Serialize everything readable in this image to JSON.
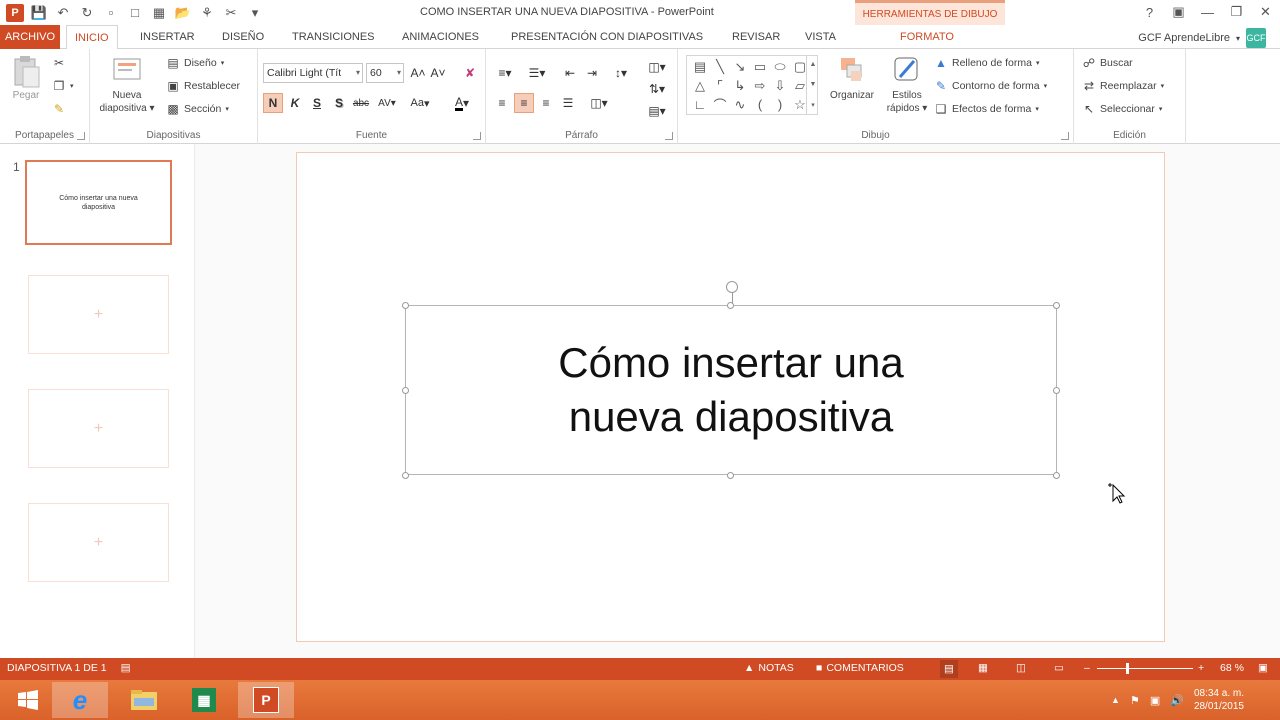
{
  "window": {
    "title": "COMO INSERTAR UNA NUEVA DIAPOSITIVA - PowerPoint",
    "context_header": "HERRAMIENTAS DE DIBUJO",
    "app_logo": "P"
  },
  "tabs": [
    {
      "label": "ARCHIVO"
    },
    {
      "label": "INICIO"
    },
    {
      "label": "INSERTAR"
    },
    {
      "label": "DISEÑO"
    },
    {
      "label": "TRANSICIONES"
    },
    {
      "label": "ANIMACIONES"
    },
    {
      "label": "PRESENTACIÓN CON DIAPOSITIVAS"
    },
    {
      "label": "REVISAR"
    },
    {
      "label": "VISTA"
    },
    {
      "label": "FORMATO"
    }
  ],
  "account": {
    "name": "GCF AprendeLibre",
    "avatar": "GCF"
  },
  "ribbon": {
    "clipboard": {
      "label": "Portapapeles",
      "paste": "Pegar"
    },
    "slides": {
      "label": "Diapositivas",
      "new_slide_line1": "Nueva",
      "new_slide_line2": "diapositiva",
      "layout": "Diseño",
      "reset": "Restablecer",
      "section": "Sección"
    },
    "font": {
      "label": "Fuente",
      "font_name": "Calibri Light (Tít",
      "font_size": "60",
      "bold": "N",
      "italic": "K",
      "underline": "S",
      "shadow": "S",
      "strike": "abc",
      "spacing": "AV",
      "case": "Aa"
    },
    "paragraph": {
      "label": "Párrafo"
    },
    "drawing": {
      "label": "Dibujo",
      "arrange": "Organizar",
      "quick_styles_line1": "Estilos",
      "quick_styles_line2": "rápidos",
      "fill": "Relleno de forma",
      "outline": "Contorno de forma",
      "effects": "Efectos de forma"
    },
    "editing": {
      "label": "Edición",
      "find": "Buscar",
      "replace": "Reemplazar",
      "select": "Seleccionar"
    }
  },
  "thumbnails": {
    "number": "1",
    "slide1_text": "Cómo insertar una nueva diapositiva"
  },
  "slide": {
    "title_line1": "Cómo insertar una",
    "title_line2": "nueva diapositiva"
  },
  "status": {
    "slide_count": "DIAPOSITIVA 1 DE 1",
    "notes": "NOTAS",
    "comments": "COMENTARIOS",
    "zoom": "68 %"
  },
  "clock": {
    "time": "08:34 a. m.",
    "date": "28/01/2015"
  }
}
